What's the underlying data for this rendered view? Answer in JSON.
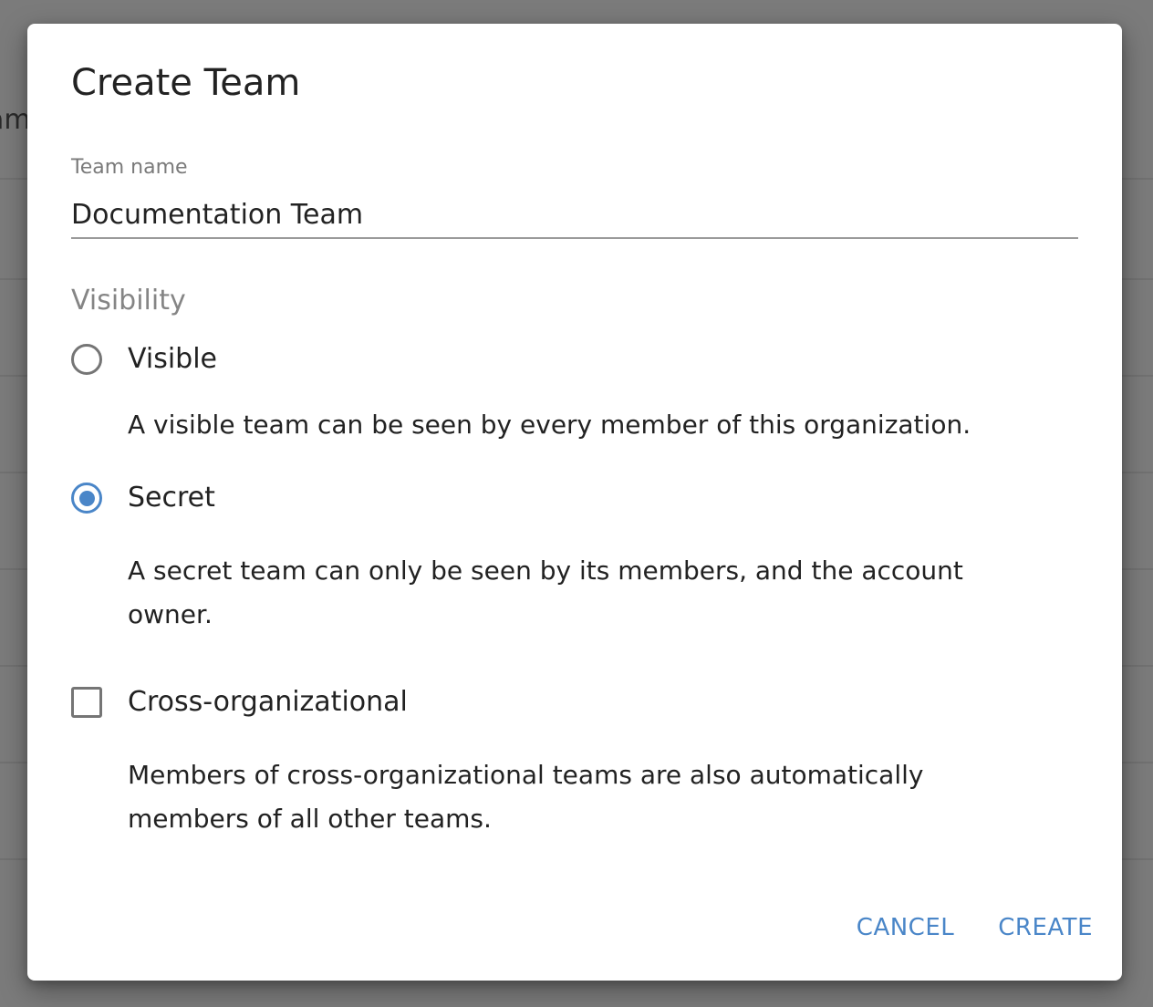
{
  "background": {
    "peek_text": "am"
  },
  "dialog": {
    "title": "Create Team",
    "team_name": {
      "label": "Team name",
      "value": "Documentation Team"
    },
    "visibility": {
      "label": "Visibility",
      "selected": "secret",
      "options": [
        {
          "id": "visible",
          "label": "Visible",
          "description": "A visible team can be seen by every member of this organization.",
          "checked": false
        },
        {
          "id": "secret",
          "label": "Secret",
          "description": "A secret team can only be seen by its members, and the account owner.",
          "checked": true
        }
      ]
    },
    "cross_org": {
      "label": "Cross-organizational",
      "description": "Members of cross-organizational teams are also automatically members of all other teams.",
      "checked": false
    },
    "actions": {
      "cancel_label": "CANCEL",
      "create_label": "CREATE"
    }
  },
  "colors": {
    "accent": "#4a86c8",
    "backdrop": "#7b7b7b",
    "text": "#222222",
    "muted_text": "#7a7a7a"
  }
}
